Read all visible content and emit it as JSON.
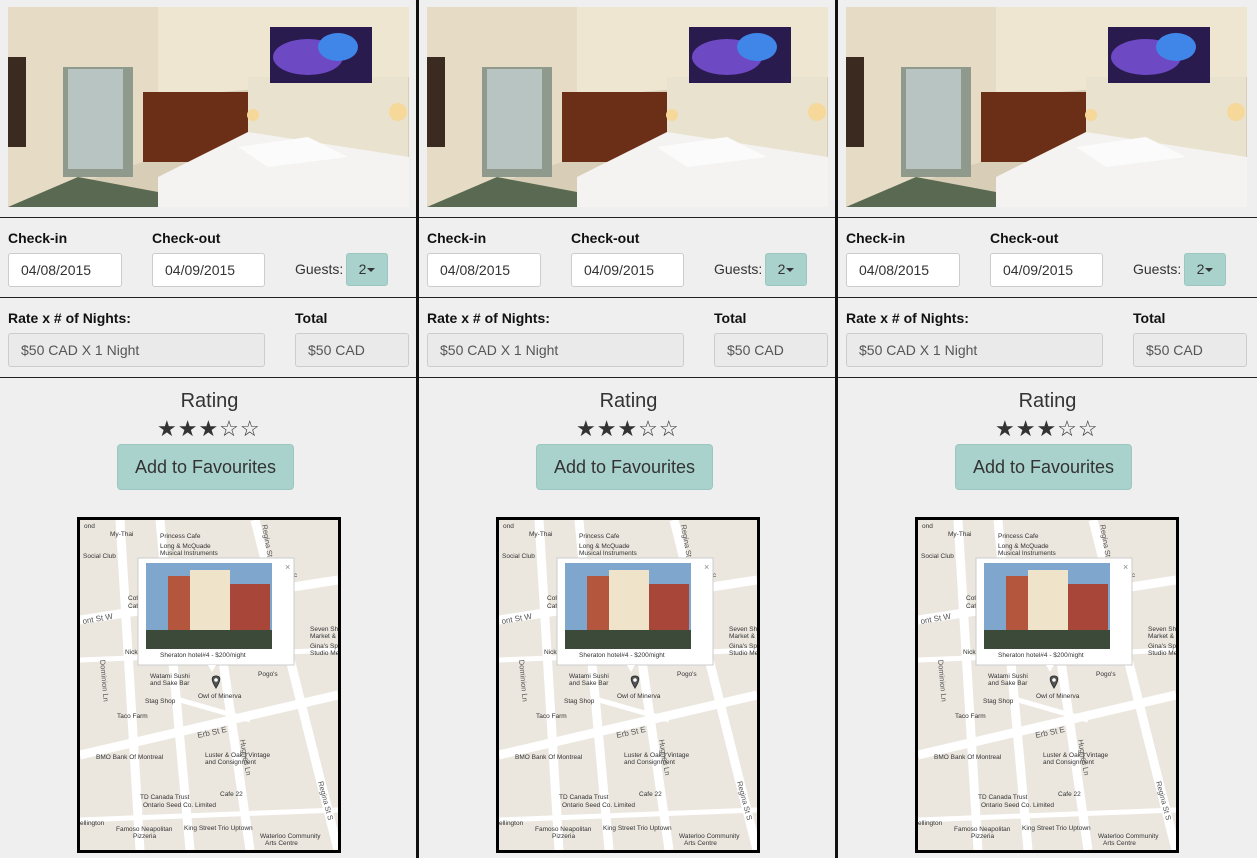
{
  "listings": [
    {
      "checkin_label": "Check-in",
      "checkout_label": "Check-out",
      "checkin_value": "04/08/2015",
      "checkout_value": "04/09/2015",
      "guests_label": "Guests:",
      "guests_value": "2",
      "rate_label": "Rate x # of Nights:",
      "rate_value": "$50 CAD X 1 Night",
      "total_label": "Total",
      "total_value": "$50 CAD",
      "rating_title": "Rating",
      "rating_stars": 3,
      "rating_max": 5,
      "favourite_label": "Add to Favourites",
      "map": {
        "popup_caption": "Sheraton hotel#4 - $200/night",
        "close_glyph": "×",
        "labels": [
          "My-Thai",
          "Princess Cafe",
          "Long & McQuade",
          "Musical Instruments",
          "Social Club",
          "Regina St N",
          "Coffee",
          "Cafe",
          "ont St W",
          "Seven Shop",
          "Market & Ca",
          "Gina's Spa",
          "Studio Medi",
          "Nick",
          "Watami Sushi",
          "and Sake Bar",
          "Pogo's",
          "Dominion Ln",
          "Stag Shop",
          "Owl of Minerva",
          "Taco Farm",
          "Erb St E",
          "Luster & Oak | Vintage",
          "and Consignment",
          "BMO Bank Of Montreal",
          "Hughes Ln",
          "Regina St S",
          "TD Canada Trust",
          "Cafe 22",
          "Ontario Seed Co. Limited",
          "Famoso Neapolitan",
          "Pizzeria",
          "King Street Trio Uptown",
          "Waterloo Community",
          "Arts Centre",
          "ellington",
          "Music",
          "ond"
        ]
      }
    },
    {
      "checkin_label": "Check-in",
      "checkout_label": "Check-out",
      "checkin_value": "04/08/2015",
      "checkout_value": "04/09/2015",
      "guests_label": "Guests:",
      "guests_value": "2",
      "rate_label": "Rate x # of Nights:",
      "rate_value": "$50 CAD X 1 Night",
      "total_label": "Total",
      "total_value": "$50 CAD",
      "rating_title": "Rating",
      "rating_stars": 3,
      "rating_max": 5,
      "favourite_label": "Add to Favourites",
      "map": {
        "popup_caption": "Sheraton hotel#4 - $200/night",
        "close_glyph": "×",
        "labels": [
          "My-Thai",
          "Princess Cafe",
          "Long & McQuade",
          "Musical Instruments",
          "Social Club",
          "Regina St N",
          "Coffee",
          "Cafe",
          "ont St W",
          "Seven Shop",
          "Market & Ca",
          "Gina's Spa",
          "Studio Medi",
          "Nick",
          "Watami Sushi",
          "and Sake Bar",
          "Pogo's",
          "Dominion Ln",
          "Stag Shop",
          "Owl of Minerva",
          "Taco Farm",
          "Erb St E",
          "Luster & Oak | Vintage",
          "and Consignment",
          "BMO Bank Of Montreal",
          "Hughes Ln",
          "Regina St S",
          "TD Canada Trust",
          "Cafe 22",
          "Ontario Seed Co. Limited",
          "Famoso Neapolitan",
          "Pizzeria",
          "King Street Trio Uptown",
          "Waterloo Community",
          "Arts Centre",
          "ellington",
          "Music",
          "ond"
        ]
      }
    },
    {
      "checkin_label": "Check-in",
      "checkout_label": "Check-out",
      "checkin_value": "04/08/2015",
      "checkout_value": "04/09/2015",
      "guests_label": "Guests:",
      "guests_value": "2",
      "rate_label": "Rate x # of Nights:",
      "rate_value": "$50 CAD X 1 Night",
      "total_label": "Total",
      "total_value": "$50 CAD",
      "rating_title": "Rating",
      "rating_stars": 3,
      "rating_max": 5,
      "favourite_label": "Add to Favourites",
      "map": {
        "popup_caption": "Sheraton hotel#4 - $200/night",
        "close_glyph": "×",
        "labels": [
          "My-Thai",
          "Princess Cafe",
          "Long & McQuade",
          "Musical Instruments",
          "Social Club",
          "Regina St N",
          "Coffee",
          "Cafe",
          "ont St W",
          "Seven Shop",
          "Market & Ca",
          "Gina's Spa",
          "Studio Medi",
          "Nick",
          "Watami Sushi",
          "and Sake Bar",
          "Pogo's",
          "Dominion Ln",
          "Stag Shop",
          "Owl of Minerva",
          "Taco Farm",
          "Erb St E",
          "Luster & Oak | Vintage",
          "and Consignment",
          "BMO Bank Of Montreal",
          "Hughes Ln",
          "Regina St S",
          "TD Canada Trust",
          "Cafe 22",
          "Ontario Seed Co. Limited",
          "Famoso Neapolitan",
          "Pizzeria",
          "King Street Trio Uptown",
          "Waterloo Community",
          "Arts Centre",
          "ellington",
          "Music",
          "ond"
        ]
      }
    }
  ],
  "colors": {
    "accent_button": "#a9d2cc",
    "page_background": "#efefef",
    "divider": "#111111"
  },
  "icons": {
    "star_filled": "★",
    "star_empty": "☆",
    "dropdown": "caret-down-icon",
    "map_pin": "map-pin-icon",
    "popup_close": "close-icon"
  }
}
